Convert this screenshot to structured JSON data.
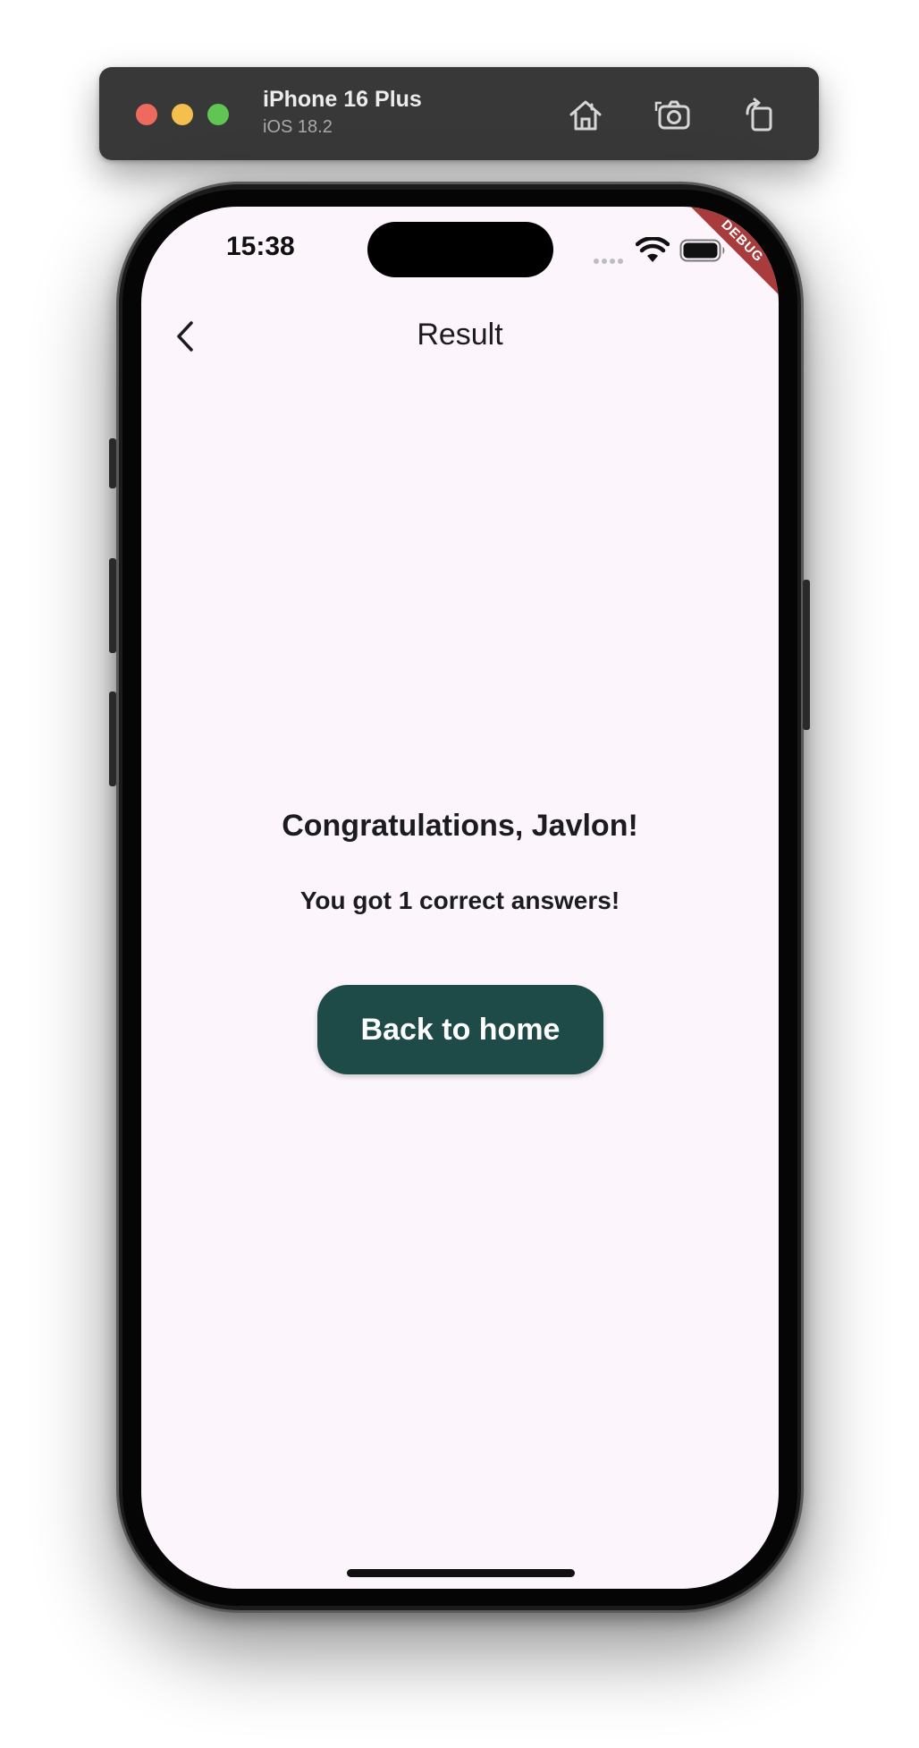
{
  "simulator": {
    "device_name": "iPhone 16 Plus",
    "os_version": "iOS 18.2",
    "toolbar_icons": [
      "home-icon",
      "screenshot-icon",
      "rotate-icon"
    ]
  },
  "status_bar": {
    "time": "15:38",
    "debug_label": "DEBUG"
  },
  "app_bar": {
    "title": "Result",
    "back_icon": "chevron-left-icon"
  },
  "content": {
    "congrats": "Congratulations, Javlon!",
    "score": "You got 1 correct answers!",
    "back_home_label": "Back to home"
  },
  "colors": {
    "background": "#fcf6fc",
    "button": "#1e4a47",
    "debug_banner": "#a83c3c"
  }
}
